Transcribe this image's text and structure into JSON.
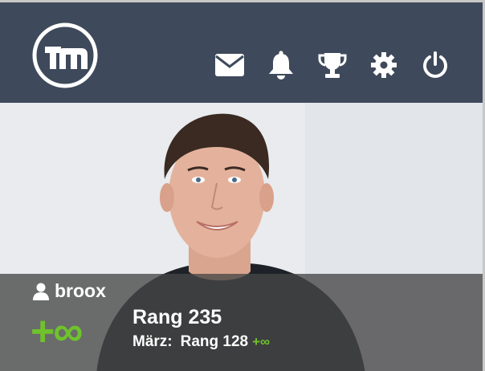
{
  "header": {
    "logo_text": "tm",
    "icons": [
      {
        "name": "mail-icon"
      },
      {
        "name": "bell-icon"
      },
      {
        "name": "trophy-icon"
      },
      {
        "name": "gear-icon"
      },
      {
        "name": "power-icon"
      }
    ]
  },
  "profile": {
    "username": "broox",
    "points": "+∞",
    "rank": "Rang 235",
    "month_label": "März:",
    "month_rank": "Rang 128",
    "month_points": "+∞"
  },
  "colors": {
    "header_bg": "#3e4a5b",
    "accent_green": "#6fc22c",
    "overlay": "rgba(70,70,70,0.78)"
  }
}
